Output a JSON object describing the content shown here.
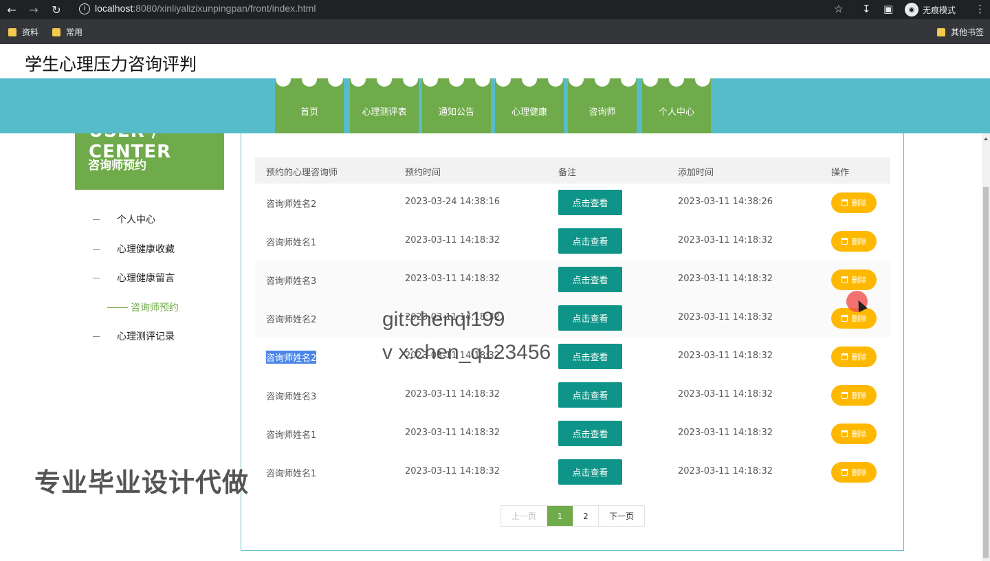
{
  "browser": {
    "url_host": "localhost",
    "url_rest": ":8080/xinliyalizixunpingpan/front/index.html",
    "incognito_label": "无痕模式",
    "bookmarks": [
      "资料",
      "常用"
    ],
    "other_bookmarks": "其他书签"
  },
  "site": {
    "title": "学生心理压力咨询评判"
  },
  "nav": [
    "首页",
    "心理测评表",
    "通知公告",
    "心理健康",
    "咨询师",
    "个人中心"
  ],
  "sidebar": {
    "en_title": "USER / CENTER",
    "title": "咨询师预约",
    "items": [
      "个人中心",
      "心理健康收藏",
      "心理健康留言",
      "咨询师预约",
      "心理测评记录"
    ],
    "active_index": 3
  },
  "table": {
    "headers": [
      "预约的心理咨询师",
      "预约时间",
      "备注",
      "添加时间",
      "操作"
    ],
    "view_label": "点击查看",
    "delete_label": "删除",
    "rows": [
      [
        "咨询师姓名2",
        "2023-03-24 14:38:16",
        "2023-03-11 14:38:26"
      ],
      [
        "咨询师姓名1",
        "2023-03-11 14:18:32",
        "2023-03-11 14:18:32"
      ],
      [
        "咨询师姓名3",
        "2023-03-11 14:18:32",
        "2023-03-11 14:18:32"
      ],
      [
        "咨询师姓名2",
        "2023-03-11 14:18:32",
        "2023-03-11 14:18:32"
      ],
      [
        "咨询师姓名2",
        "2023-03-11 14:18:32",
        "2023-03-11 14:18:32"
      ],
      [
        "咨询师姓名3",
        "2023-03-11 14:18:32",
        "2023-03-11 14:18:32"
      ],
      [
        "咨询师姓名1",
        "2023-03-11 14:18:32",
        "2023-03-11 14:18:32"
      ],
      [
        "咨询师姓名1",
        "2023-03-11 14:18:32",
        "2023-03-11 14:18:32"
      ]
    ]
  },
  "pager": {
    "prev": "上一页",
    "pages": [
      "1",
      "2"
    ],
    "current": "1",
    "next": "下一页"
  },
  "overlay": {
    "watermark_line1": "git:chenqi199",
    "watermark_line2": "v x:chen_q123456",
    "watermark_line3": "专业毕业设计代做"
  },
  "colors": {
    "nav_band": "#56bcc9",
    "green": "#6fab4a",
    "teal_button": "#0e9488",
    "delete_button": "#ffb800"
  }
}
